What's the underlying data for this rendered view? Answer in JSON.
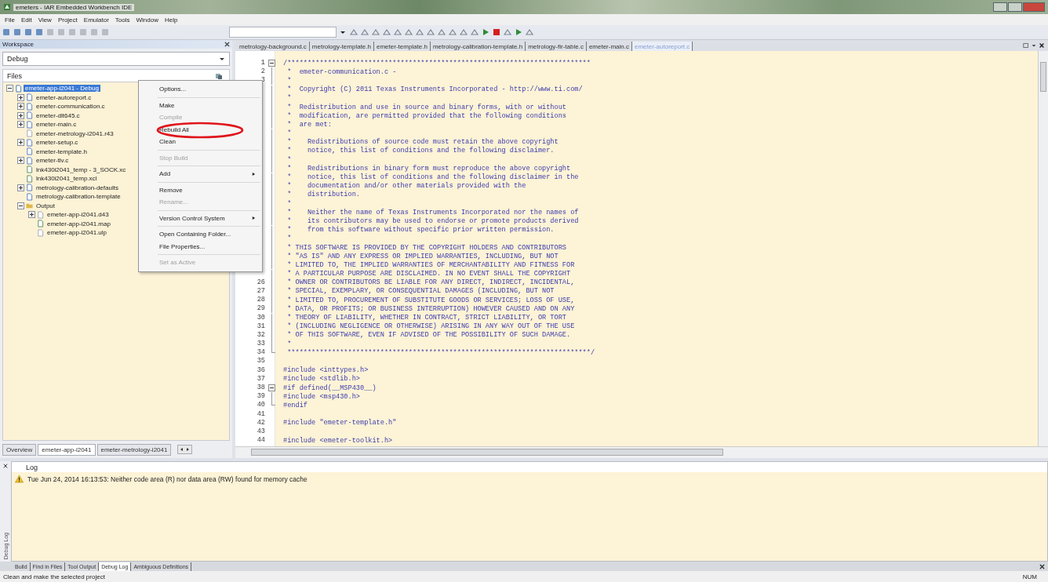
{
  "window": {
    "title": "emeters - IAR Embedded Workbench IDE"
  },
  "menu_bar": [
    "File",
    "Edit",
    "View",
    "Project",
    "Emulator",
    "Tools",
    "Window",
    "Help"
  ],
  "workspace": {
    "title": "Workspace",
    "configuration": "Debug",
    "files_header": "Files",
    "tree": [
      {
        "label": "emeter-app-i2041 - Debug",
        "kind": "project",
        "selected": true,
        "expanded": true,
        "children": [
          {
            "label": "emeter-autoreport.c",
            "kind": "source",
            "selected": false,
            "expanded": false
          },
          {
            "label": "emeter-communication.c",
            "kind": "source",
            "selected": false,
            "expanded": false
          },
          {
            "label": "emeter-dlt645.c",
            "kind": "source",
            "selected": false,
            "expanded": false
          },
          {
            "label": "emeter-main.c",
            "kind": "source",
            "selected": false,
            "expanded": false
          },
          {
            "label": "emeter-metrology-i2041.r43",
            "kind": "object",
            "selected": false
          },
          {
            "label": "emeter-setup.c",
            "kind": "source",
            "selected": false,
            "expanded": false
          },
          {
            "label": "emeter-template.h",
            "kind": "source",
            "selected": false
          },
          {
            "label": "emeter-tlv.c",
            "kind": "source",
            "selected": false,
            "expanded": false
          },
          {
            "label": "lnk430i2041_temp - 3_SOCK.xc",
            "kind": "linker",
            "selected": false
          },
          {
            "label": "lnk430i2041_temp.xcl",
            "kind": "linker",
            "selected": false
          },
          {
            "label": "metrology-calibration-defaults",
            "kind": "source",
            "selected": false,
            "expanded": false
          },
          {
            "label": "metrology-calibration-template",
            "kind": "source",
            "selected": false
          },
          {
            "label": "Output",
            "kind": "folder",
            "selected": false,
            "expanded": true,
            "children": [
              {
                "label": "emeter-app-i2041.d43",
                "kind": "object",
                "selected": false,
                "expanded": false
              },
              {
                "label": "emeter-app-i2041.map",
                "kind": "linker",
                "selected": false
              },
              {
                "label": "emeter-app-i2041.ulp",
                "kind": "object",
                "selected": false
              }
            ]
          }
        ]
      }
    ],
    "tabs": [
      {
        "label": "Overview",
        "selected": false
      },
      {
        "label": "emeter-app-i2041",
        "selected": true
      },
      {
        "label": "emeter-metrology-i2041",
        "selected": false
      }
    ]
  },
  "context_menu": {
    "items": [
      {
        "kind": "item",
        "label": "Options...",
        "disabled": false,
        "submenu": false,
        "circled": false
      },
      {
        "kind": "separator"
      },
      {
        "kind": "item",
        "label": "Make",
        "disabled": false,
        "submenu": false,
        "circled": false
      },
      {
        "kind": "item",
        "label": "Compile",
        "disabled": true,
        "submenu": false,
        "circled": false
      },
      {
        "kind": "item",
        "label": "Rebuild All",
        "disabled": false,
        "submenu": false,
        "circled": true
      },
      {
        "kind": "item",
        "label": "Clean",
        "disabled": false,
        "submenu": false,
        "circled": false
      },
      {
        "kind": "separator"
      },
      {
        "kind": "item",
        "label": "Stop Build",
        "disabled": true,
        "submenu": false,
        "circled": false
      },
      {
        "kind": "separator"
      },
      {
        "kind": "item",
        "label": "Add",
        "disabled": false,
        "submenu": true,
        "circled": false
      },
      {
        "kind": "separator"
      },
      {
        "kind": "item",
        "label": "Remove",
        "disabled": false,
        "submenu": false,
        "circled": false
      },
      {
        "kind": "item",
        "label": "Rename...",
        "disabled": true,
        "submenu": false,
        "circled": false
      },
      {
        "kind": "separator"
      },
      {
        "kind": "item",
        "label": "Version Control System",
        "disabled": false,
        "submenu": true,
        "circled": false
      },
      {
        "kind": "separator"
      },
      {
        "kind": "item",
        "label": "Open Containing Folder...",
        "disabled": false,
        "submenu": false,
        "circled": false
      },
      {
        "kind": "item",
        "label": "File Properties...",
        "disabled": false,
        "submenu": false,
        "circled": false
      },
      {
        "kind": "separator"
      },
      {
        "kind": "item",
        "label": "Set as Active",
        "disabled": true,
        "submenu": false,
        "circled": false
      }
    ]
  },
  "editor": {
    "tabs": [
      {
        "label": "metrology-background.c",
        "selected": false
      },
      {
        "label": "metrology-template.h",
        "selected": false
      },
      {
        "label": "emeter-template.h",
        "selected": false
      },
      {
        "label": "metrology-calibration-template.h",
        "selected": false
      },
      {
        "label": "metrology-fir-table.c",
        "selected": false
      },
      {
        "label": "emeter-main.c",
        "selected": false
      },
      {
        "label": "emeter-autoreport.c",
        "selected": true
      }
    ],
    "lines": [
      {
        "number": "1",
        "kind": "fold-start",
        "text": "/***************************************************************************"
      },
      {
        "number": "2",
        "kind": "line",
        "text": " *  emeter-communication.c -"
      },
      {
        "number": "3",
        "kind": "line",
        "text": " *"
      },
      {
        "kind": "line",
        "text": " *  Copyright (C) 2011 Texas Instruments Incorporated - http://www.ti.com/"
      },
      {
        "kind": "line",
        "text": " *"
      },
      {
        "kind": "line",
        "text": " *  Redistribution and use in source and binary forms, with or without"
      },
      {
        "kind": "line",
        "text": " *  modification, are permitted provided that the following conditions"
      },
      {
        "kind": "line",
        "text": " *  are met:"
      },
      {
        "kind": "line",
        "text": " *"
      },
      {
        "kind": "line",
        "text": " *    Redistributions of source code must retain the above copyright"
      },
      {
        "kind": "line",
        "text": " *    notice, this list of conditions and the following disclaimer."
      },
      {
        "kind": "line",
        "text": " *"
      },
      {
        "kind": "line",
        "text": " *    Redistributions in binary form must reproduce the above copyright"
      },
      {
        "kind": "line",
        "text": " *    notice, this list of conditions and the following disclaimer in the"
      },
      {
        "kind": "line",
        "text": " *    documentation and/or other materials provided with the"
      },
      {
        "kind": "line",
        "text": " *    distribution."
      },
      {
        "kind": "line",
        "text": " *"
      },
      {
        "kind": "line",
        "text": " *    Neither the name of Texas Instruments Incorporated nor the names of"
      },
      {
        "kind": "line",
        "text": " *    its contributors may be used to endorse or promote products derived"
      },
      {
        "kind": "line",
        "text": " *    from this software without specific prior written permission."
      },
      {
        "kind": "line",
        "text": " *"
      },
      {
        "kind": "line",
        "text": " * THIS SOFTWARE IS PROVIDED BY THE COPYRIGHT HOLDERS AND CONTRIBUTORS"
      },
      {
        "kind": "line",
        "text": " * \"AS IS\" AND ANY EXPRESS OR IMPLIED WARRANTIES, INCLUDING, BUT NOT"
      },
      {
        "kind": "line",
        "text": " * LIMITED TO, THE IMPLIED WARRANTIES OF MERCHANTABILITY AND FITNESS FOR"
      },
      {
        "kind": "line",
        "text": " * A PARTICULAR PURPOSE ARE DISCLAIMED. IN NO EVENT SHALL THE COPYRIGHT"
      },
      {
        "number": "26",
        "kind": "line",
        "text": " * OWNER OR CONTRIBUTORS BE LIABLE FOR ANY DIRECT, INDIRECT, INCIDENTAL,"
      },
      {
        "number": "27",
        "kind": "line",
        "text": " * SPECIAL, EXEMPLARY, OR CONSEQUENTIAL DAMAGES (INCLUDING, BUT NOT"
      },
      {
        "number": "28",
        "kind": "line",
        "text": " * LIMITED TO, PROCUREMENT OF SUBSTITUTE GOODS OR SERVICES; LOSS OF USE,"
      },
      {
        "number": "29",
        "kind": "line",
        "text": " * DATA, OR PROFITS; OR BUSINESS INTERRUPTION) HOWEVER CAUSED AND ON ANY"
      },
      {
        "number": "30",
        "kind": "line",
        "text": " * THEORY OF LIABILITY, WHETHER IN CONTRACT, STRICT LIABILITY, OR TORT"
      },
      {
        "number": "31",
        "kind": "line",
        "text": " * (INCLUDING NEGLIGENCE OR OTHERWISE) ARISING IN ANY WAY OUT OF THE USE"
      },
      {
        "number": "32",
        "kind": "line",
        "text": " * OF THIS SOFTWARE, EVEN IF ADVISED OF THE POSSIBILITY OF SUCH DAMAGE."
      },
      {
        "number": "33",
        "kind": "line",
        "text": " *"
      },
      {
        "number": "34",
        "kind": "fold-end",
        "text": " ***************************************************************************/"
      },
      {
        "number": "35",
        "kind": "line"
      },
      {
        "number": "36",
        "kind": "line",
        "text": "#include <inttypes.h>"
      },
      {
        "number": "37",
        "kind": "line",
        "text": "#include <stdlib.h>"
      },
      {
        "number": "38",
        "kind": "fold-start",
        "text": "#if defined(__MSP430__)"
      },
      {
        "number": "39",
        "kind": "line",
        "text": "#include <msp430.h>"
      },
      {
        "number": "40",
        "kind": "fold-end",
        "text": "#endif"
      },
      {
        "number": "41",
        "kind": "line"
      },
      {
        "number": "42",
        "kind": "line",
        "text": "#include \"emeter-template.h\""
      },
      {
        "number": "43",
        "kind": "line"
      },
      {
        "number": "44",
        "kind": "line",
        "text": "#include <emeter-toolkit.h>"
      }
    ]
  },
  "log": {
    "side_label": "Debug Log",
    "header": "Log",
    "messages": [
      {
        "kind": "warning",
        "text": "Tue Jun 24, 2014 16:13:53: Neither code area (R) nor data area (RW) found for memory cache"
      }
    ],
    "tabs": [
      {
        "label": "Build",
        "selected": false
      },
      {
        "label": "Find in Files",
        "selected": false
      },
      {
        "label": "Tool Output",
        "selected": false
      },
      {
        "label": "Debug Log",
        "selected": true
      },
      {
        "label": "Ambiguous Definitions",
        "selected": false
      }
    ]
  },
  "status_bar": {
    "message": "Clean and make the selected project",
    "indicator": "NUM"
  }
}
